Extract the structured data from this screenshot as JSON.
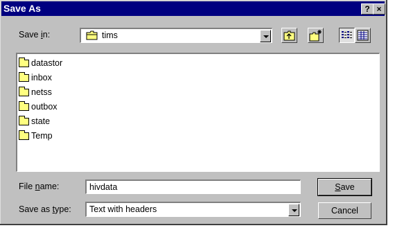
{
  "title": "Save As",
  "title_buttons": {
    "help": "?",
    "close": "×"
  },
  "save_in": {
    "label_pre": "Save ",
    "label_key": "i",
    "label_post": "n:",
    "value": "tims"
  },
  "folders": [
    "datastor",
    "inbox",
    "netss",
    "outbox",
    "state",
    "Temp"
  ],
  "file_name": {
    "label_pre": "File ",
    "label_key": "n",
    "label_post": "ame:",
    "value": "hivdata"
  },
  "save_type": {
    "label_pre": "Save as ",
    "label_key": "t",
    "label_post": "ype:",
    "value": "Text with headers"
  },
  "buttons": {
    "save_key": "S",
    "save_rest": "ave",
    "cancel": "Cancel"
  },
  "icons": [
    "folder-icon",
    "up-one-level-icon",
    "new-folder-icon",
    "list-view-icon",
    "details-view-icon",
    "dropdown-arrow-icon"
  ]
}
